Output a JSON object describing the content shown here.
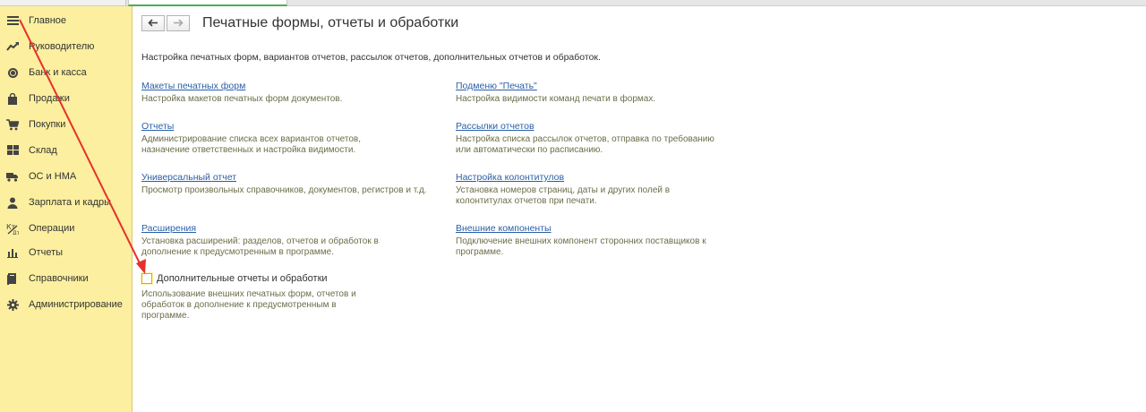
{
  "colors": {
    "sidebar_bg": "#fcef9f",
    "link": "#2a5fa7",
    "description": "#6d6d4a",
    "annotation_arrow": "#e8302a",
    "checkbox_focus": "#e0a800"
  },
  "sidebar": {
    "items": [
      {
        "label": "Главное",
        "icon": "hamburger-menu-icon"
      },
      {
        "label": "Руководителю",
        "icon": "trend-chart-icon"
      },
      {
        "label": "Банк и касса",
        "icon": "coins-icon"
      },
      {
        "label": "Продажи",
        "icon": "shopping-bag-icon"
      },
      {
        "label": "Покупки",
        "icon": "shopping-cart-icon"
      },
      {
        "label": "Склад",
        "icon": "warehouse-grid-icon"
      },
      {
        "label": "ОС и НМА",
        "icon": "truck-icon"
      },
      {
        "label": "Зарплата и кадры",
        "icon": "person-icon"
      },
      {
        "label": "Операции",
        "icon": "operations-icon"
      },
      {
        "label": "Отчеты",
        "icon": "bar-chart-icon"
      },
      {
        "label": "Справочники",
        "icon": "book-icon"
      },
      {
        "label": "Администрирование",
        "icon": "gear-icon"
      }
    ]
  },
  "header": {
    "back_icon": "arrow-left-icon",
    "forward_icon": "arrow-right-icon",
    "title": "Печатные формы, отчеты и обработки"
  },
  "main": {
    "intro": "Настройка печатных форм, вариантов отчетов, рассылок отчетов, дополнительных отчетов и обработок.",
    "left_column": [
      {
        "link": "Макеты печатных форм",
        "desc": [
          "Настройка макетов печатных форм документов."
        ]
      },
      {
        "link": "Отчеты",
        "desc": [
          "Администрирование списка всех вариантов отчетов,",
          "назначение ответственных и настройка видимости."
        ]
      },
      {
        "link": "Универсальный отчет",
        "desc": [
          "Просмотр произвольных справочников, документов, регистров и т.д."
        ]
      },
      {
        "link": "Расширения",
        "desc": [
          "Установка расширений: разделов, отчетов и обработок в",
          "дополнение к предусмотренным в программе."
        ]
      }
    ],
    "right_column": [
      {
        "link": "Подменю \"Печать\"",
        "desc": [
          "Настройка видимости команд печати в формах."
        ]
      },
      {
        "link": "Рассылки отчетов",
        "desc": [
          "Настройка списка рассылок отчетов, отправка по требованию",
          "или автоматически по расписанию."
        ]
      },
      {
        "link": "Настройка колонтитулов",
        "desc": [
          "Установка номеров страниц, даты и других полей в",
          "колонтитулах отчетов при печати."
        ]
      },
      {
        "link": "Внешние компоненты",
        "desc": [
          "Подключение внешних компонент сторонних поставщиков к",
          "программе."
        ]
      }
    ],
    "checkbox": {
      "label": "Дополнительные отчеты и обработки",
      "checked": false,
      "desc": [
        "Использование внешних печатных форм, отчетов и",
        "обработок в дополнение к предусмотренным в",
        "программе."
      ]
    }
  }
}
